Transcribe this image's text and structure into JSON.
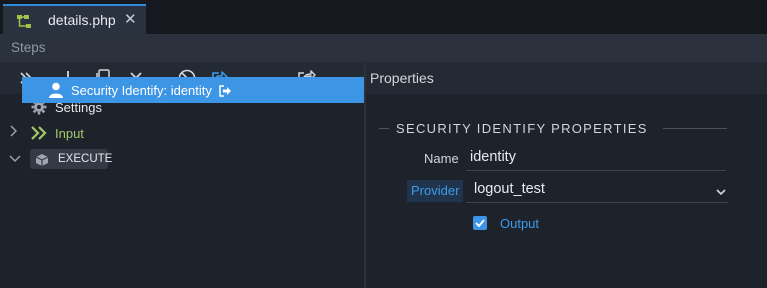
{
  "tab": {
    "file_name": "details.php",
    "close_glyph": "✕"
  },
  "left": {
    "header_title": "Steps",
    "toolbar": [
      "expand-all-icon",
      "add-icon",
      "copy-icon",
      "delete-icon",
      "disable-icon",
      "move-icon",
      "export-icon",
      "more-icon"
    ],
    "more_glyph": "···",
    "tree": {
      "settings": "Settings",
      "input": "Input",
      "execute": "EXECUTE",
      "step": "Security Identify: identity"
    }
  },
  "right": {
    "header_title": "Properties",
    "section_title": "SECURITY IDENTIFY PROPERTIES",
    "name_label": "Name",
    "name_value": "identity",
    "provider_label": "Provider",
    "provider_value": "logout_test",
    "output_label": "Output",
    "output_checked": true
  },
  "colors": {
    "accent": "#3d95e6",
    "input_green": "#a3c86a",
    "tab_border": "#2f8bd8",
    "link_blue": "#3d9be9"
  }
}
